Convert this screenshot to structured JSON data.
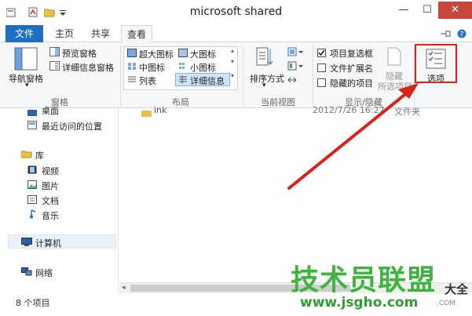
{
  "window": {
    "title": "microsoft shared",
    "minimize_glyph": "—",
    "maximize_glyph": "☐",
    "close_glyph": "✕"
  },
  "tabs": [
    {
      "label": "文件"
    },
    {
      "label": "主页"
    },
    {
      "label": "共享"
    },
    {
      "label": "查看"
    }
  ],
  "ribbon": {
    "pane_group": {
      "label": "窗格",
      "nav_pane": "导航窗格",
      "preview_pane": "预览窗格",
      "details_pane": "详细信息窗格"
    },
    "layout_group": {
      "label": "布局",
      "items": [
        "超大图标",
        "大图标",
        "中图标",
        "小图标",
        "列表",
        "详细信息"
      ]
    },
    "current_view_group": {
      "label": "当前视图",
      "sort_by": "排序方式"
    },
    "show_hide_group": {
      "label": "显示/隐藏",
      "item_checkboxes": "项目复选框",
      "file_extensions": "文件扩展名",
      "hidden_items": "隐藏的项目",
      "hide_selected_line1": "隐藏",
      "hide_selected_line2": "所选项目"
    },
    "options": "选项"
  },
  "nav": {
    "desktop": "桌面",
    "recent": "最近访问的位置",
    "libraries": "库",
    "videos": "视频",
    "pictures": "图片",
    "documents": "文档",
    "music": "音乐",
    "computer": "计算机",
    "network": "网络"
  },
  "content": {
    "row_name": "ink",
    "row_date": "2012/7/26 16:27",
    "row_type": "文件夹"
  },
  "status": {
    "item_count": "8 个项目"
  },
  "watermark": {
    "brand": "技术员联盟",
    "url": "www.jsgho.com",
    "suffix": "大全",
    "tld_fragment": ".COM"
  },
  "colors": {
    "accent_blue": "#1e6ec2",
    "highlight_red": "#d8231b",
    "watermark_green": "#3db53d"
  }
}
